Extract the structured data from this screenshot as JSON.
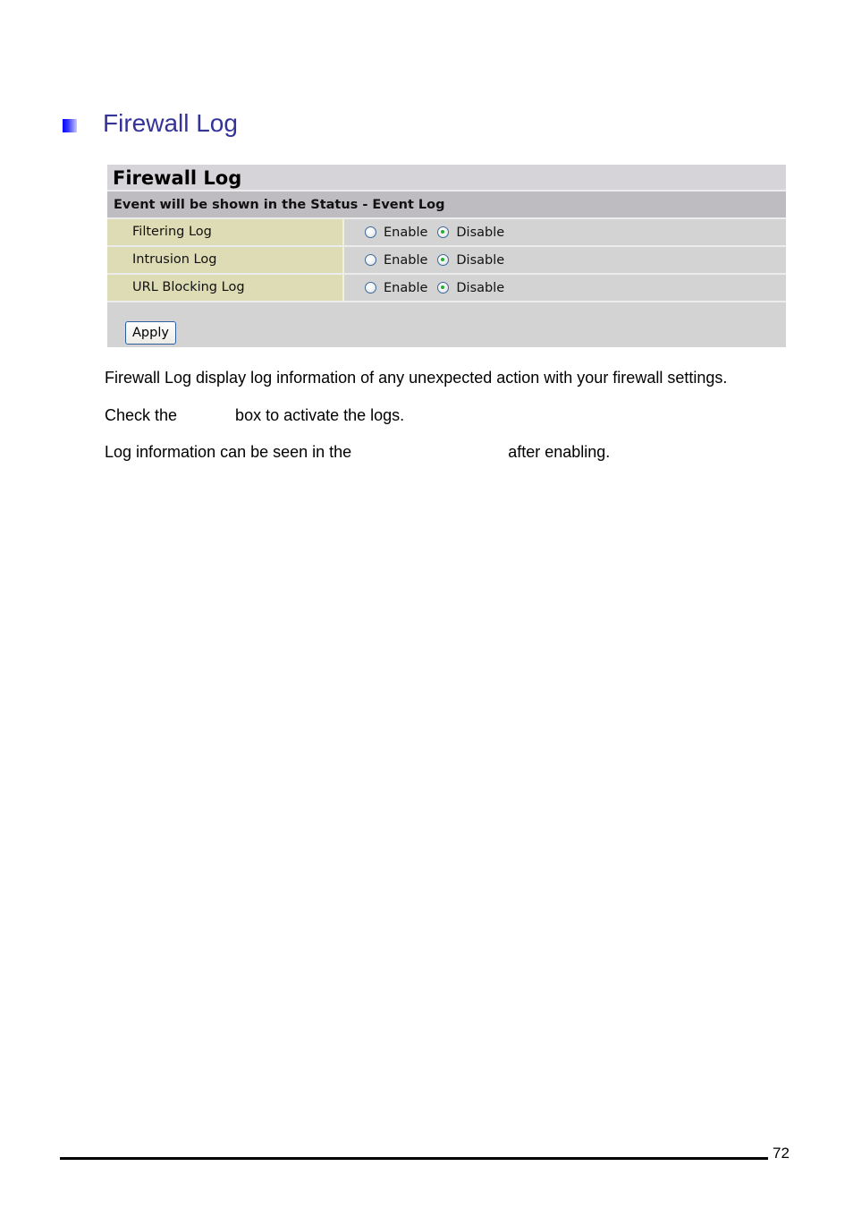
{
  "section": {
    "bullet_icon": "gradient-square-bullet",
    "title": "Firewall Log"
  },
  "panel": {
    "title": "Firewall Log",
    "subtitle": "Event will be shown in the Status - Event Log",
    "rows": [
      {
        "label": "Filtering Log",
        "enable_label": "Enable",
        "disable_label": "Disable",
        "selected": "Disable"
      },
      {
        "label": "Intrusion Log",
        "enable_label": "Enable",
        "disable_label": "Disable",
        "selected": "Disable"
      },
      {
        "label": "URL Blocking Log",
        "enable_label": "Enable",
        "disable_label": "Disable",
        "selected": "Disable"
      }
    ],
    "apply_label": "Apply"
  },
  "body": {
    "paragraph1": "Firewall Log display log information of any unexpected action with your firewall settings.",
    "paragraph2": "Check the             box to activate the logs.",
    "paragraph3": "Log information can be seen in the                                   after enabling."
  },
  "footer": {
    "page_number": "72"
  }
}
